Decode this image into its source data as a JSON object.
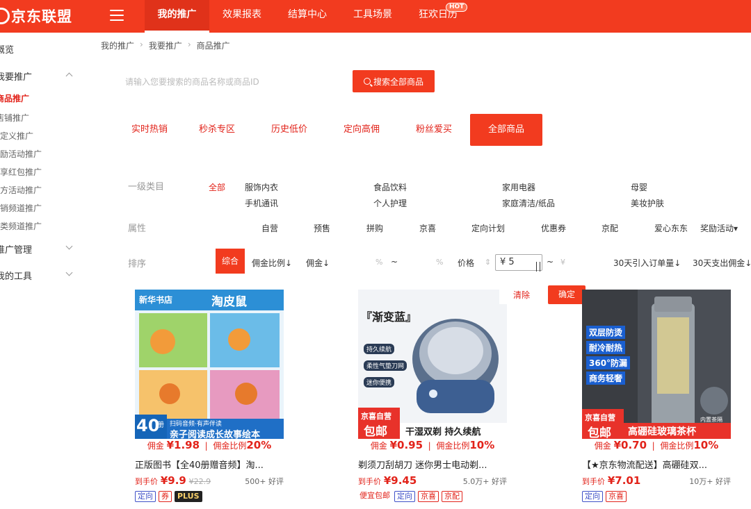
{
  "app": {
    "logo_text": "京东联盟"
  },
  "nav": [
    {
      "label": "我的推广"
    },
    {
      "label": "效果报表"
    },
    {
      "label": "结算中心"
    },
    {
      "label": "工具场景"
    },
    {
      "label": "狂欢日历",
      "badge": "HOT"
    }
  ],
  "sidebar": {
    "overview": "概览",
    "promote": "我要推广",
    "items": [
      "商品推广",
      "店铺推广",
      "自定义推广",
      "奖励活动推广",
      "分享红包推广",
      "官方活动推广",
      "营销频道推广",
      "品类频道推广"
    ],
    "manage": "推广管理",
    "tools": "我的工具"
  },
  "breadcrumb": [
    "我的推广",
    "我要推广",
    "商品推广"
  ],
  "search": {
    "placeholder": "请输入您要搜索的商品名称或商品ID",
    "button": "搜索全部商品"
  },
  "tabs": [
    "实时热销",
    "秒杀专区",
    "历史低价",
    "定向高佣",
    "粉丝爱买",
    "全部商品"
  ],
  "filters": {
    "category_label": "一级类目",
    "categories": [
      "全部",
      "服饰内衣",
      "食品饮料",
      "家用电器",
      "母婴",
      "手机通讯",
      "个人护理",
      "家庭清洁/纸品",
      "美妆护肤"
    ],
    "attr_label": "属性",
    "attributes": [
      "自营",
      "预售",
      "拼购",
      "京喜",
      "定向计划",
      "优惠券",
      "京配",
      "爱心东东",
      "奖励活动▾"
    ],
    "sort_label": "排序",
    "sort_active": "综合",
    "sorts": [
      "佣金比例↓",
      "佣金↓",
      "%",
      "~",
      "%",
      "价格",
      "~",
      "¥",
      "30天引入订单量↓",
      "30天支出佣金↓"
    ],
    "price_min": "¥ 5",
    "clear": "清除",
    "confirm": "确定"
  },
  "colors": {
    "brand": "#f23b1f",
    "link": "#e2231a",
    "tag_blue": "#3f51c8"
  },
  "products": [
    {
      "commission_label": "佣金",
      "commission": "¥1.98",
      "rate_label": "佣金比例",
      "rate": "20%",
      "title": "正版图书【全40册赠音频】淘...",
      "price_label": "到手价",
      "price": "¥9.9",
      "old_price": "¥22.9",
      "reviews": "500+ 好评",
      "tags": [
        "定向",
        "券",
        "PLUS"
      ],
      "image_text": {
        "top_left": "新华书店",
        "brand": "淘皮鼠",
        "count": "40",
        "count_unit": "册",
        "scan": "扫码音频·有声伴读",
        "banner": "亲子阅读成长故事绘本"
      }
    },
    {
      "commission_label": "佣金",
      "commission": "¥0.95",
      "rate_label": "佣金比例",
      "rate": "10%",
      "title": "剃须刀刮胡刀 迷你男士电动剃...",
      "price_label": "到手价",
      "price": "¥9.45",
      "old_price": "",
      "reviews": "5.0万+ 好评",
      "tags": [
        "便宜包邮",
        "定向",
        "京喜",
        "京配"
      ],
      "image_text": {
        "headline": "『渐变蓝』",
        "features": [
          "持久续航",
          "柔性气垫刀网",
          "迷你便携"
        ],
        "badge_top": "京喜自营",
        "badge_bottom": "包邮",
        "banner": "干湿双剃  持久续航"
      }
    },
    {
      "commission_label": "佣金",
      "commission": "¥0.70",
      "rate_label": "佣金比例",
      "rate": "10%",
      "title": "【★京东物流配送】高硼硅双...",
      "price_label": "到手价",
      "price": "¥7.01",
      "old_price": "",
      "reviews": "10万+ 好评",
      "tags": [
        "定向",
        "京喜"
      ],
      "image_text": {
        "features": [
          "双层防烫",
          "耐冷耐热",
          "360°防漏",
          "商务轻奢"
        ],
        "badge_top": "京喜自营",
        "badge_bottom": "包邮",
        "banner": "高硼硅玻璃茶杯",
        "inner": "内置茶隔"
      }
    }
  ]
}
